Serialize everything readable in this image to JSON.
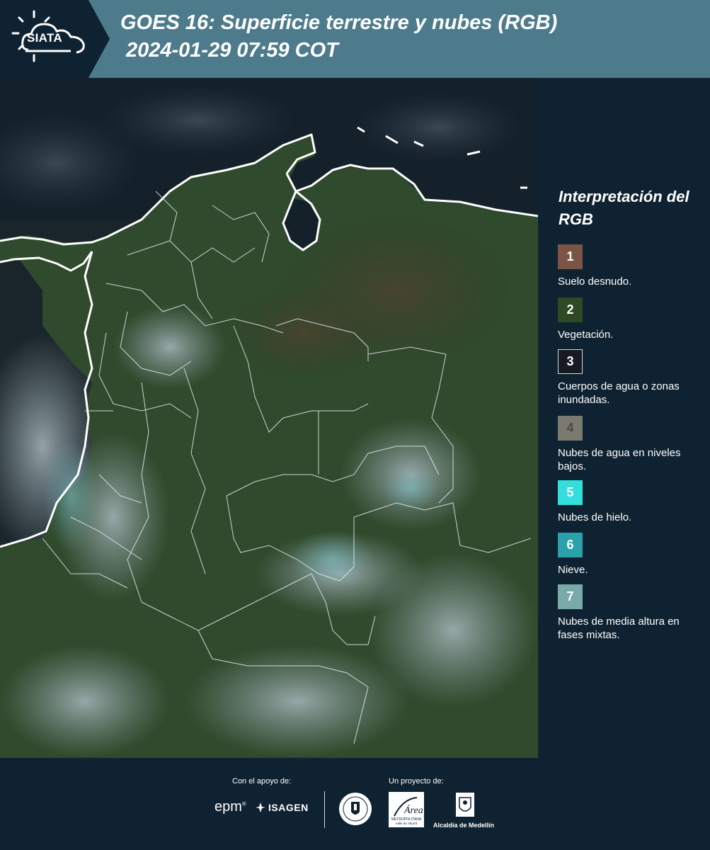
{
  "header": {
    "logo_text": "SIATA",
    "title_line1": "GOES 16: Superficie terrestre y nubes (RGB)",
    "title_line2": "2024-01-29 07:59 COT"
  },
  "legend": {
    "title": "Interpretación del RGB",
    "items": [
      {
        "number": "1",
        "label": "Suelo desnudo.",
        "color": "#7b5446"
      },
      {
        "number": "2",
        "label": "Vegetación.",
        "color": "#2d4a24"
      },
      {
        "number": "3",
        "label": "Cuerpos de agua o zonas inundadas.",
        "color": "#171a22"
      },
      {
        "number": "4",
        "label": "Nubes de agua en niveles bajos.",
        "color": "#7a7a70"
      },
      {
        "number": "5",
        "label": "Nubes de hielo.",
        "color": "#33dedc"
      },
      {
        "number": "6",
        "label": "Nieve.",
        "color": "#2aa1ab"
      },
      {
        "number": "7",
        "label": "Nubes de media altura en fases mixtas.",
        "color": "#7aa9aa"
      }
    ]
  },
  "footer": {
    "support_label": "Con el apoyo de:",
    "project_label": "Un proyecto de:",
    "epm": "epm",
    "isagen": "ISAGEN",
    "area_line1": "Área",
    "area_line2": "METROPOLITANA",
    "area_line3": "Valle de Aburrá",
    "alcaldia": "Alcaldía de Medellín"
  },
  "colors": {
    "header_bg": "#4e7b8b",
    "logo_bg": "#0f2231",
    "page_bg": "#0f2231",
    "ocean": "#1b2c30",
    "vegetation": "#2e4a2c",
    "cloud": "#8a9aa0"
  }
}
